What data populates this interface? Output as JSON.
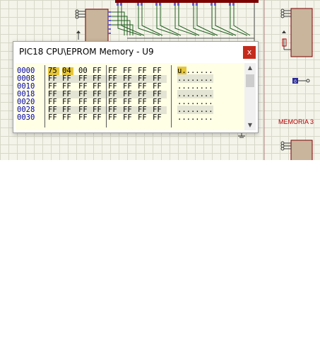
{
  "window": {
    "title": "PIC18 CPU\\EPROM Memory - U9",
    "close_glyph": "x"
  },
  "memory": {
    "addresses": [
      "0000",
      "0008",
      "0010",
      "0018",
      "0020",
      "0028",
      "0030"
    ],
    "rows": [
      [
        "75",
        "04",
        "00",
        "FF",
        "FF",
        "FF",
        "FF",
        "FF"
      ],
      [
        "FF",
        "FF",
        "FF",
        "FF",
        "FF",
        "FF",
        "FF",
        "FF"
      ],
      [
        "FF",
        "FF",
        "FF",
        "FF",
        "FF",
        "FF",
        "FF",
        "FF"
      ],
      [
        "FF",
        "FF",
        "FF",
        "FF",
        "FF",
        "FF",
        "FF",
        "FF"
      ],
      [
        "FF",
        "FF",
        "FF",
        "FF",
        "FF",
        "FF",
        "FF",
        "FF"
      ],
      [
        "FF",
        "FF",
        "FF",
        "FF",
        "FF",
        "FF",
        "FF",
        "FF"
      ],
      [
        "FF",
        "FF",
        "FF",
        "FF",
        "FF",
        "FF",
        "FF",
        "FF"
      ]
    ],
    "ascii": [
      "u.......",
      "........",
      "........",
      "........",
      "........",
      "........",
      "........"
    ],
    "highlight_color": "#e6c63a",
    "address_color": "#0000b0"
  },
  "scrollbar": {
    "up_icon": "chevron-up-icon",
    "down_icon": "chevron-down-icon"
  },
  "schematic": {
    "label": "MEMORIA 3",
    "probe_value": "0",
    "label_color": "#b00000",
    "bus_color": "#7a0000"
  }
}
